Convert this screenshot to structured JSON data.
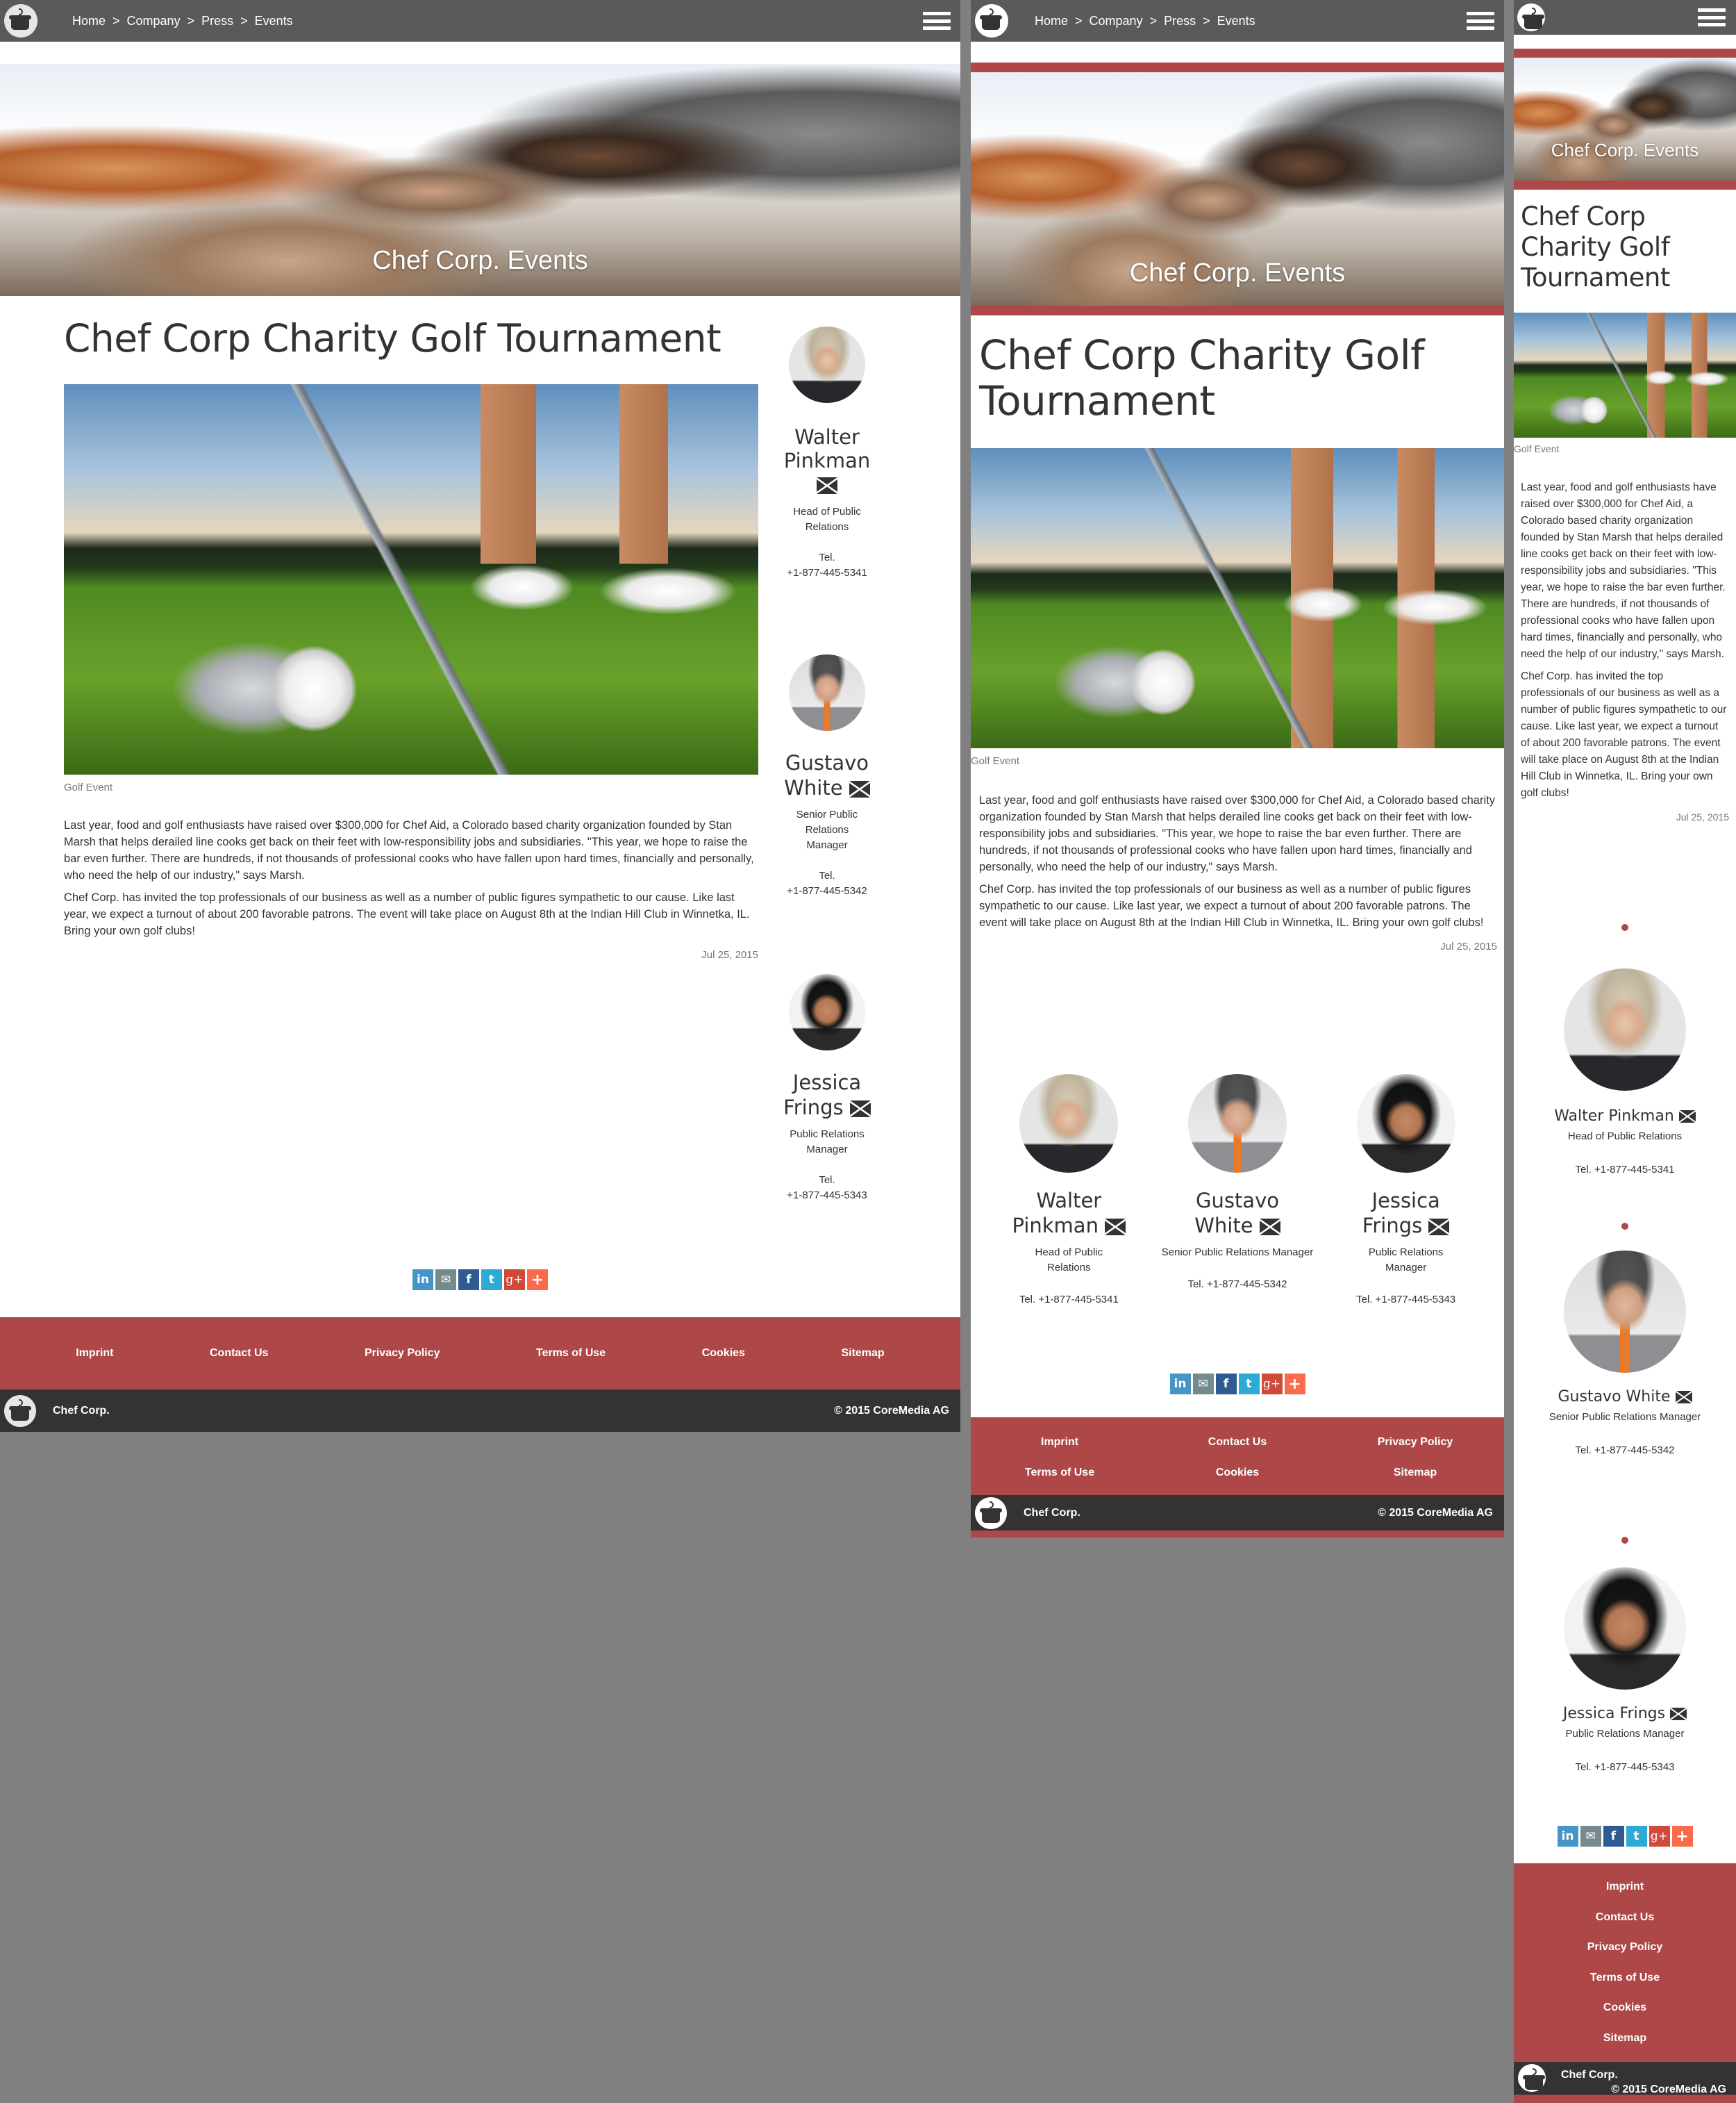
{
  "breadcrumb": [
    "Home",
    "Company",
    "Press",
    "Events"
  ],
  "breadcrumb_separator": ">",
  "hero": {
    "title": "Chef Corp. Events"
  },
  "article": {
    "title": "Chef Corp Charity Golf Tournament",
    "image_caption": "Golf Event",
    "paragraphs": [
      "Last year, food and golf enthusiasts have raised over $300,000 for Chef Aid, a Colorado based charity organization founded by Stan Marsh that helps derailed line cooks get back on their feet with low-responsibility jobs and subsidiaries. \"This year, we hope to raise the bar even further. There are hundreds, if not thousands of professional cooks who have fallen upon hard times, financially and personally, who need the help of our industry,\" says Marsh.",
      "Chef Corp. has invited the top professionals of our business as well as a number of public figures sympathetic to our cause. Like last year, we expect a turnout of about 200 favorable patrons. The event will take place on August 8th at the Indian Hill Club in Winnetka, IL. Bring your own golf clubs!"
    ],
    "date": "Jul 25, 2015"
  },
  "contacts": [
    {
      "first": "Walter",
      "last": "Pinkman",
      "name": "Walter Pinkman",
      "role": "Head of Public Relations",
      "tel_label": "Tel.",
      "tel": "+1-877-445-5341",
      "tel_full": "Tel. +1-877-445-5341"
    },
    {
      "first": "Gustavo",
      "last": "White",
      "name": "Gustavo White",
      "role": "Senior Public Relations Manager",
      "tel_label": "Tel.",
      "tel": "+1-877-445-5342",
      "tel_full": "Tel. +1-877-445-5342"
    },
    {
      "first": "Jessica",
      "last": "Frings",
      "name": "Jessica Frings",
      "role": "Public Relations Manager",
      "tel_label": "Tel.",
      "tel": "+1-877-445-5343",
      "tel_full": "Tel. +1-877-445-5343"
    }
  ],
  "share": [
    {
      "icon": "linkedin-icon",
      "glyph": "in"
    },
    {
      "icon": "email-icon",
      "glyph": "✉"
    },
    {
      "icon": "facebook-icon",
      "glyph": "f"
    },
    {
      "icon": "twitter-icon",
      "glyph": "t"
    },
    {
      "icon": "google-plus-icon",
      "glyph": "g+"
    },
    {
      "icon": "more-share-icon",
      "glyph": "+"
    }
  ],
  "footer": {
    "links": [
      "Imprint",
      "Contact Us",
      "Privacy Policy",
      "Terms of Use",
      "Cookies",
      "Sitemap"
    ],
    "brand": "Chef Corp.",
    "copyright": "© 2015 CoreMedia AG"
  },
  "colors": {
    "header_bg": "#5a5a5a",
    "accent_red": "#ae4848",
    "footer_dark": "#333333",
    "page_bg": "#808080"
  }
}
